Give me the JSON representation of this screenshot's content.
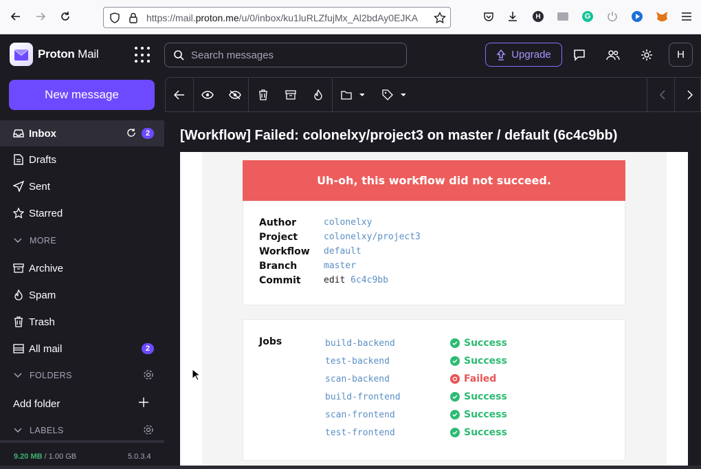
{
  "browser": {
    "url_host": "https://mail.",
    "url_domain": "proton.me",
    "url_path": "/u/0/inbox/ku1luRLZfujMx_Al2bdAy0EJKA"
  },
  "header": {
    "brand_strong": "Proton",
    "brand_light": "Mail",
    "search_placeholder": "Search messages",
    "upgrade_label": "Upgrade",
    "avatar_initial": "H"
  },
  "sidebar": {
    "new_message": "New message",
    "items": [
      {
        "label": "Inbox",
        "badge": "2"
      },
      {
        "label": "Drafts"
      },
      {
        "label": "Sent"
      },
      {
        "label": "Starred"
      },
      {
        "label": "Archive"
      },
      {
        "label": "Spam"
      },
      {
        "label": "Trash"
      },
      {
        "label": "All mail",
        "badge": "2"
      }
    ],
    "more_label": "MORE",
    "folders_label": "FOLDERS",
    "add_folder": "Add folder",
    "labels_label": "LABELS",
    "storage_used": "9.20 MB",
    "storage_total": " / 1.00 GB",
    "version": "5.0.3.4"
  },
  "message": {
    "subject": "[Workflow] Failed: colonelxy/project3 on master / default (6c4c9bb)",
    "banner": "Uh-oh, this workflow did not succeed.",
    "meta": {
      "author_key": "Author",
      "author_val": "colonelxy",
      "project_key": "Project",
      "project_val": "colonelxy/project3",
      "workflow_key": "Workflow",
      "workflow_val": "default",
      "branch_key": "Branch",
      "branch_val": "master",
      "commit_key": "Commit",
      "commit_prefix": "edit ",
      "commit_val": "6c4c9bb"
    },
    "jobs_label": "Jobs",
    "jobs": [
      {
        "name": "build-backend",
        "status": "Success"
      },
      {
        "name": "test-backend",
        "status": "Success"
      },
      {
        "name": "scan-backend",
        "status": "Failed"
      },
      {
        "name": "build-frontend",
        "status": "Success"
      },
      {
        "name": "scan-frontend",
        "status": "Success"
      },
      {
        "name": "test-frontend",
        "status": "Success"
      }
    ]
  },
  "colors": {
    "accent": "#6d4aff",
    "success": "#2dbb73",
    "failed": "#e85656",
    "banner": "#ed5d5d",
    "link": "#5a8fc4"
  }
}
